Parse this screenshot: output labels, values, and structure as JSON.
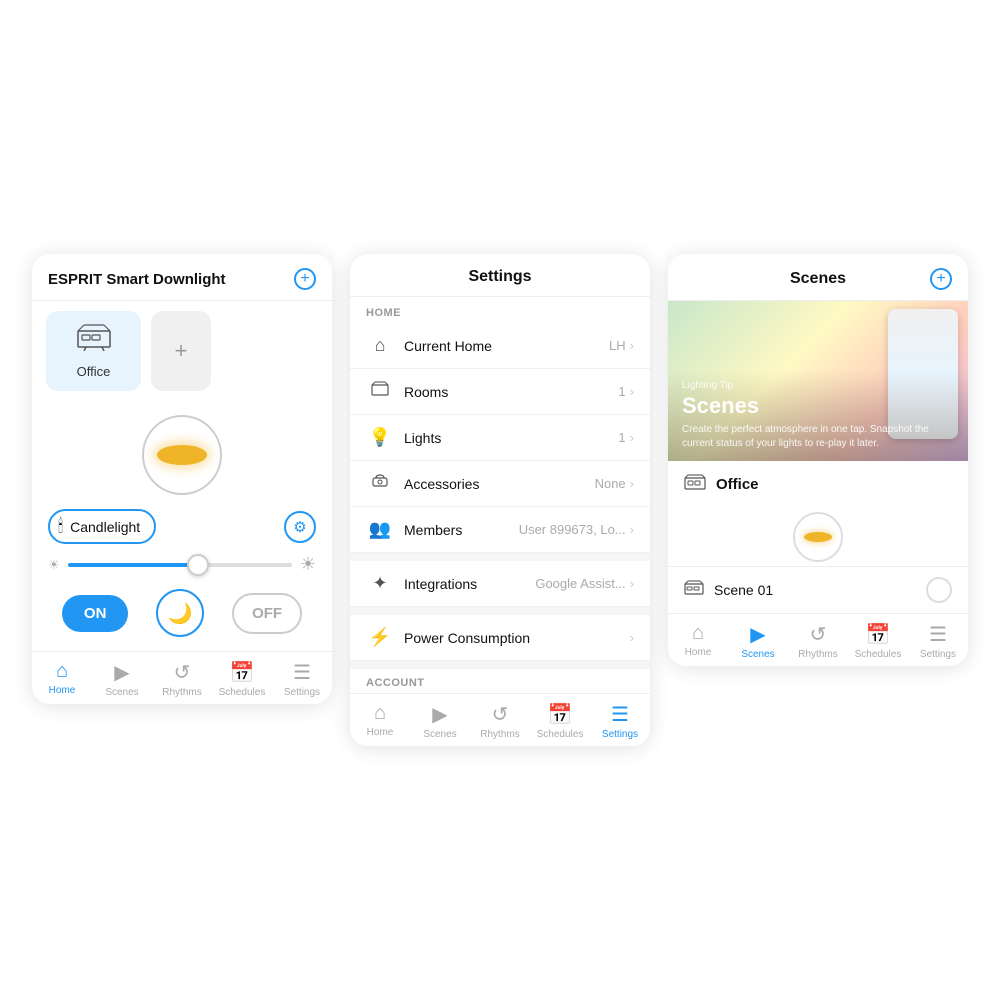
{
  "screen1": {
    "header": {
      "title": "ESPRIT Smart Downlight",
      "add_label": "+"
    },
    "rooms": [
      {
        "label": "Office",
        "icon": "🖥"
      }
    ],
    "add_room_icon": "+",
    "scene": {
      "name": "Candlelight",
      "icon": "🕯"
    },
    "brightness": {
      "low_icon": "☀",
      "high_icon": "☀"
    },
    "controls": {
      "on_label": "ON",
      "off_label": "OFF"
    },
    "nav": [
      {
        "label": "Home",
        "icon": "⌂",
        "active": true
      },
      {
        "label": "Scenes",
        "icon": "▶",
        "active": false
      },
      {
        "label": "Rhythms",
        "icon": "↺",
        "active": false
      },
      {
        "label": "Schedules",
        "icon": "📅",
        "active": false
      },
      {
        "label": "Settings",
        "icon": "☰",
        "active": false
      }
    ]
  },
  "screen2": {
    "header": {
      "title": "Settings"
    },
    "section_home": "HOME",
    "section_account": "ACCOUNT",
    "rows": [
      {
        "label": "Current Home",
        "value": "LH",
        "icon": "⌂"
      },
      {
        "label": "Rooms",
        "value": "1",
        "icon": "▦"
      },
      {
        "label": "Lights",
        "value": "1",
        "icon": "💡"
      },
      {
        "label": "Accessories",
        "value": "None",
        "icon": "📡"
      },
      {
        "label": "Members",
        "value": "User 899673, Lo...",
        "icon": "👥"
      },
      {
        "label": "Integrations",
        "value": "Google Assist...",
        "icon": "✦"
      },
      {
        "label": "Power Consumption",
        "value": "",
        "icon": "⚡"
      }
    ],
    "nav": [
      {
        "label": "Home",
        "icon": "⌂",
        "active": false
      },
      {
        "label": "Scenes",
        "icon": "▶",
        "active": false
      },
      {
        "label": "Rhythms",
        "icon": "↺",
        "active": false
      },
      {
        "label": "Schedules",
        "icon": "📅",
        "active": false
      },
      {
        "label": "Settings",
        "icon": "☰",
        "active": true
      }
    ]
  },
  "screen3": {
    "header": {
      "title": "Scenes",
      "add_label": "+"
    },
    "hero": {
      "tip": "Lighting Tip",
      "title": "Scenes",
      "description": "Create the perfect atmosphere in one tap. Snapshot the current status of your lights to re-play it later."
    },
    "section_office": "Office",
    "scene_name": "Scene 01",
    "nav": [
      {
        "label": "Home",
        "icon": "⌂",
        "active": false
      },
      {
        "label": "Scenes",
        "icon": "▶",
        "active": true
      },
      {
        "label": "Rhythms",
        "icon": "↺",
        "active": false
      },
      {
        "label": "Schedules",
        "icon": "📅",
        "active": false
      },
      {
        "label": "Settings",
        "icon": "☰",
        "active": false
      }
    ]
  }
}
